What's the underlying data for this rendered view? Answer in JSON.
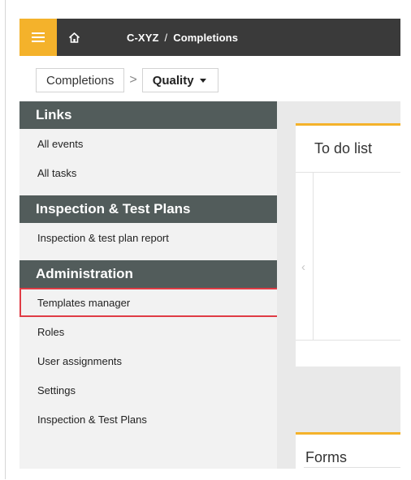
{
  "topbar": {
    "menu_icon": "hamburger-icon",
    "home_icon": "home-icon",
    "breadcrumb": {
      "project": "C-XYZ",
      "separator": "/",
      "module": "Completions"
    }
  },
  "subnav": {
    "tab_completions": "Completions",
    "separator": ">",
    "tab_quality": "Quality"
  },
  "sidebar": {
    "links_header": "Links",
    "links": [
      "All events",
      "All tasks"
    ],
    "itp_header": "Inspection & Test Plans",
    "itp_items": [
      "Inspection & test plan report"
    ],
    "admin_header": "Administration",
    "admin_items": [
      "Templates manager",
      "Roles",
      "User assignments",
      "Settings",
      "Inspection & Test Plans"
    ]
  },
  "main": {
    "todo_title": "To do list",
    "prev_arrow": "‹",
    "forms_title": "Forms"
  },
  "colors": {
    "accent": "#f4b22b",
    "topbar": "#3a3a3a",
    "section_header": "#525c5b",
    "highlight": "#e03c45"
  }
}
